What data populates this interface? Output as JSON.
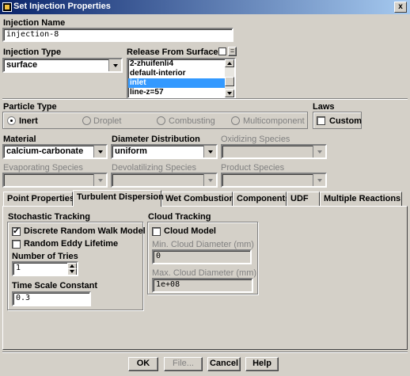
{
  "window": {
    "title": "Set Injection Properties",
    "close_glyph": "x"
  },
  "injection_name": {
    "label": "Injection Name",
    "value": "injection-8"
  },
  "injection_type": {
    "label": "Injection Type",
    "value": "surface"
  },
  "release_from_surfaces": {
    "label": "Release From Surfaces",
    "items": [
      "2-zhuifenli4",
      "default-interior",
      "inlet",
      "line-z=57"
    ],
    "selected_index": 2
  },
  "particle_type": {
    "label": "Particle Type",
    "options": [
      "Inert",
      "Droplet",
      "Combusting",
      "Multicomponent"
    ],
    "selected": "Inert"
  },
  "laws": {
    "label": "Laws",
    "custom_label": "Custom",
    "custom_checked": false
  },
  "material": {
    "label": "Material",
    "value": "calcium-carbonate"
  },
  "diameter_distribution": {
    "label": "Diameter Distribution",
    "value": "uniform"
  },
  "oxidizing_species": {
    "label": "Oxidizing Species",
    "value": ""
  },
  "evaporating_species": {
    "label": "Evaporating Species",
    "value": ""
  },
  "devolatilizing_species": {
    "label": "Devolatilizing Species",
    "value": ""
  },
  "product_species": {
    "label": "Product Species",
    "value": ""
  },
  "tabs": [
    {
      "label": "Point Properties",
      "active": false
    },
    {
      "label": "Turbulent Dispersion",
      "active": true
    },
    {
      "label": "Wet Combustion",
      "active": false
    },
    {
      "label": "Components",
      "active": false
    },
    {
      "label": "UDF",
      "active": false
    },
    {
      "label": "Multiple Reactions",
      "active": false
    }
  ],
  "stochastic_tracking": {
    "label": "Stochastic Tracking",
    "discrete_random_walk": {
      "label": "Discrete Random Walk Model",
      "checked": true
    },
    "random_eddy_lifetime": {
      "label": "Random Eddy Lifetime",
      "checked": false
    },
    "number_of_tries": {
      "label": "Number of Tries",
      "value": "1"
    },
    "time_scale_constant": {
      "label": "Time Scale Constant",
      "value": "0.3"
    }
  },
  "cloud_tracking": {
    "label": "Cloud Tracking",
    "cloud_model": {
      "label": "Cloud Model",
      "checked": false
    },
    "min_diameter": {
      "label": "Min. Cloud Diameter (mm)",
      "value": "0"
    },
    "max_diameter": {
      "label": "Max. Cloud Diameter (mm)",
      "value": "1e+08"
    }
  },
  "buttons": {
    "ok": "OK",
    "file": "File...",
    "cancel": "Cancel",
    "help": "Help"
  }
}
